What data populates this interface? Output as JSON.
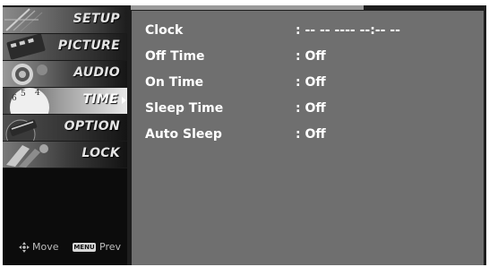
{
  "sidebar": {
    "items": [
      {
        "label": "SETUP",
        "icon": "satellite-dish-icon"
      },
      {
        "label": "PICTURE",
        "icon": "film-strip-icon"
      },
      {
        "label": "AUDIO",
        "icon": "speaker-icon"
      },
      {
        "label": "TIME",
        "icon": "clock-face-icon",
        "active": true
      },
      {
        "label": "OPTION",
        "icon": "option-tag-icon"
      },
      {
        "label": "LOCK",
        "icon": "key-lock-icon"
      }
    ],
    "footer": {
      "move_label": "Move",
      "menu_key_label": "MENU",
      "prev_label": "Prev"
    }
  },
  "settings": {
    "rows": [
      {
        "label": "Clock",
        "value": ": -- -- ---- --:-- --"
      },
      {
        "label": "Off Time",
        "value": ": Off"
      },
      {
        "label": "On Time",
        "value": ": Off"
      },
      {
        "label": "Sleep Time",
        "value": ": Off"
      },
      {
        "label": "Auto Sleep",
        "value": ": Off"
      }
    ]
  },
  "colors": {
    "panel_bg": "#6f6f6f",
    "sidebar_bg": "#0c0c0c",
    "text": "#ffffff"
  }
}
